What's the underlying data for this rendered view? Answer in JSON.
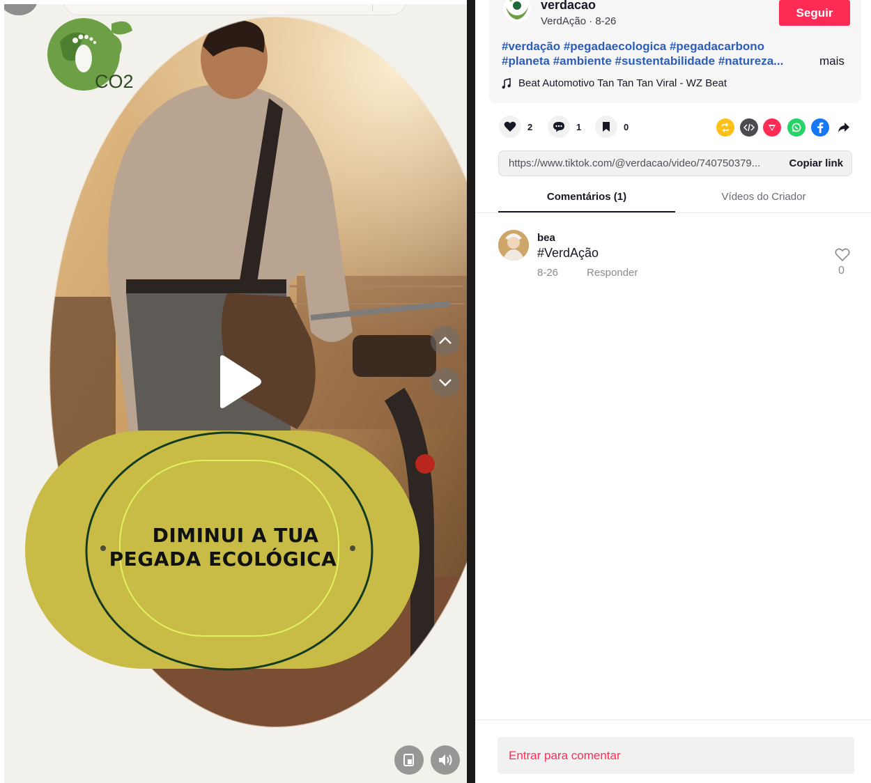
{
  "video": {
    "overlay_line1": "DIMINUI A TUA",
    "overlay_line2": "PEGADA ECOLÓGICA",
    "logo_text": "CO2",
    "controls": {
      "play_icon": "play-icon",
      "nav_up_icon": "chevron-up-icon",
      "nav_down_icon": "chevron-down-icon",
      "pip_icon": "picture-in-picture-icon",
      "volume_icon": "volume-icon"
    }
  },
  "author": {
    "name": "verdacao",
    "display_name": "VerdAção",
    "separator": "·",
    "date": "8-26",
    "meta": "VerdAção · 8-26",
    "follow_label": "Seguir"
  },
  "description": {
    "hashtags_line1": "#verdação #pegadaecologica #pegadacarbono",
    "hashtags_line2": "#planeta #ambiente #sustentabilidade #natureza...",
    "more_label": "mais",
    "music": "Beat Automotivo Tan Tan Tan Viral - WZ Beat"
  },
  "actions": {
    "likes": "2",
    "comments": "1",
    "saves": "0"
  },
  "share": {
    "icons": [
      "repost-icon",
      "embed-icon",
      "send-icon",
      "whatsapp-icon",
      "facebook-icon",
      "share-arrow-icon"
    ]
  },
  "link": {
    "url": "https://www.tiktok.com/@verdacao/video/740750379...",
    "copy_label": "Copiar link"
  },
  "tabs": {
    "comments": "Comentários (1)",
    "creator_videos": "Vídeos do Criador"
  },
  "comments": [
    {
      "user": "bea",
      "text": "#VerdAção",
      "date": "8-26",
      "reply_label": "Responder",
      "likes": "0"
    }
  ],
  "footer": {
    "login_prompt": "Entrar para comentar"
  },
  "colors": {
    "brand_red": "#fe2c55",
    "hashtag_blue": "#2b5db9",
    "overlay_olive": "#c8bc47",
    "logo_green": "#6da046"
  }
}
